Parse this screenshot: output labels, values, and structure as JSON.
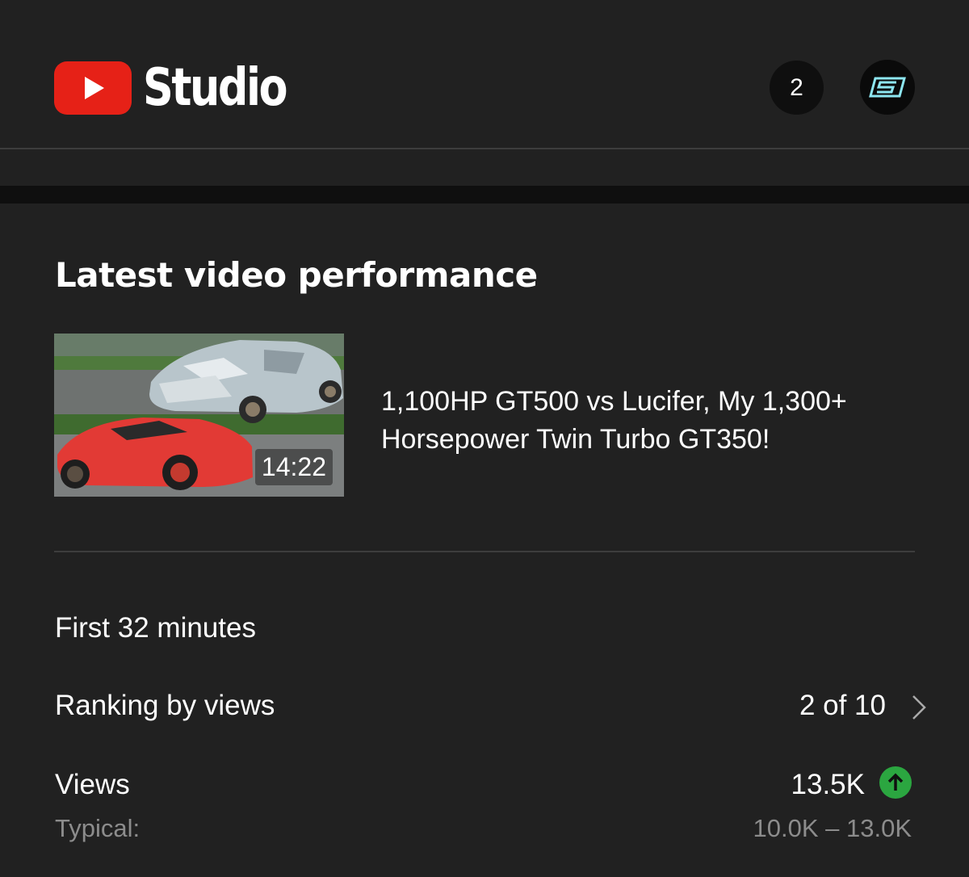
{
  "header": {
    "app_name": "Studio",
    "logo_icon": "youtube-play-icon",
    "notifications_count": "2",
    "avatar_icon": "channel-avatar-logo",
    "brand_color": "#e62117"
  },
  "card": {
    "title": "Latest video performance",
    "video": {
      "title": "1,100HP GT500 vs Lucifer, My 1,300+ Horsepower Twin Turbo GT350!",
      "duration": "14:22"
    },
    "period": "First 32 minutes",
    "ranking": {
      "label": "Ranking by views",
      "value": "2 of 10",
      "icon": "chevron-right-icon"
    },
    "views": {
      "label": "Views",
      "value": "13.5K",
      "trend_icon": "arrow-up-icon",
      "trend_color": "#2ba640",
      "typical_label": "Typical:",
      "typical_range": "10.0K – 13.0K"
    }
  }
}
